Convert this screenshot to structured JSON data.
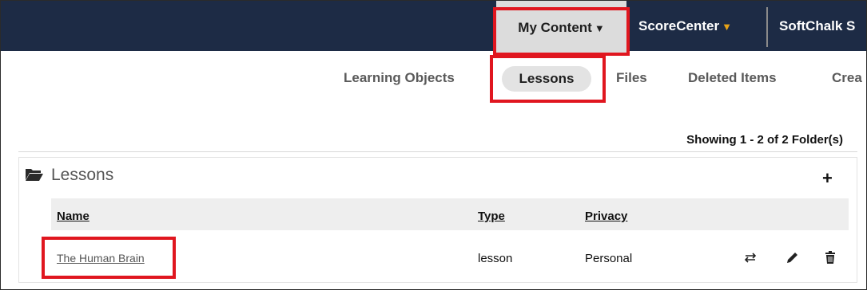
{
  "topnav": {
    "my_content": "My Content",
    "score_center": "ScoreCenter",
    "softchalk": "SoftChalk S",
    "caret_down": "▼"
  },
  "subnav": {
    "learning_objects": "Learning Objects",
    "lessons": "Lessons",
    "files": "Files",
    "deleted_items": "Deleted Items",
    "create": "Crea"
  },
  "showing_text": "Showing 1 - 2 of 2 Folder(s)",
  "folder": {
    "title": "Lessons",
    "add_symbol": "+",
    "columns": {
      "name": "Name",
      "type": "Type",
      "privacy": "Privacy"
    },
    "rows": [
      {
        "name": "The Human Brain",
        "type": "lesson",
        "privacy": "Personal",
        "actions": [
          "swap-icon",
          "edit-pencil-icon",
          "trash-icon"
        ]
      }
    ]
  },
  "colors": {
    "topbar": "#1d2b45",
    "highlight": "#e0161f",
    "accent_caret": "#e8a317"
  }
}
